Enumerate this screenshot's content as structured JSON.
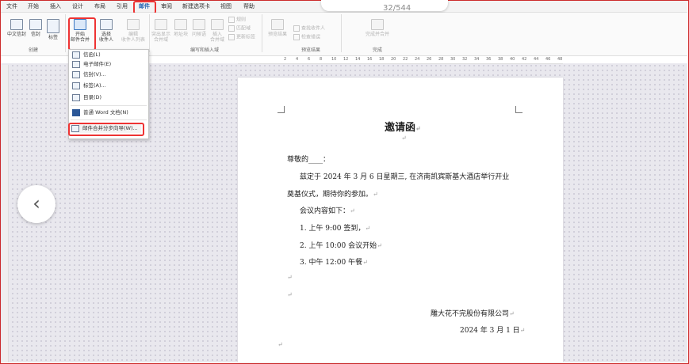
{
  "ribbon_tabs": [
    "文件",
    "开始",
    "插入",
    "设计",
    "布局",
    "引用",
    "邮件",
    "审阅",
    "新建选项卡",
    "视图",
    "帮助"
  ],
  "active_tab": "邮件",
  "page_counter": "32/544",
  "ribbon": {
    "chinese_envelope": "中文信封",
    "envelope": "信封",
    "labels": "标签",
    "start_mail_merge": [
      "开始",
      "邮件合并"
    ],
    "select_recipients": [
      "选择",
      "收件人"
    ],
    "edit_recipients": [
      "编辑",
      "收件人列表"
    ],
    "highlight_fields": [
      "突出显示",
      "合并域"
    ],
    "address_block": "地址块",
    "greeting_line": "问候语",
    "insert_merge_field": [
      "插入",
      "合并域"
    ],
    "rules": "规则",
    "match_fields": "匹配域",
    "update_labels": "更新标签",
    "preview_results": "预览结果",
    "find_recipient": "查找收件人",
    "check_errors": "检查错误",
    "finish_merge": "完成并合并",
    "groups": {
      "create": "创建",
      "write_insert": "编写和插入域",
      "preview": "预览结果",
      "finish": "完成"
    }
  },
  "dropdown": {
    "items": [
      "信函(L)",
      "电子邮件(E)",
      "信封(V)...",
      "标签(A)...",
      "目录(D)",
      "普通 Word 文档(N)",
      "邮件合并分步向导(W)..."
    ],
    "highlighted": "邮件合并分步向导(W)..."
  },
  "ruler_ticks": [
    "2",
    "4",
    "6",
    "8",
    "10",
    "12",
    "14",
    "16",
    "18",
    "20",
    "22",
    "24",
    "26",
    "28",
    "30",
    "32",
    "34",
    "36",
    "38",
    "40",
    "42",
    "44",
    "46",
    "48"
  ],
  "document": {
    "title": "邀请函",
    "salutation": "尊敬的____：",
    "body_line1": "兹定于 2024 年 3 月 6 日星期三, 在济南凯宾斯基大酒店举行开业",
    "body_line2": "奠基仪式，期待你的参加。",
    "agenda_intro": "会议内容如下：",
    "items": [
      "1.  上午 9:00 签到，",
      "2.  上午 10:00 会议开始",
      "3.  中午 12:00 午餐"
    ],
    "signature_company": "雕大花不完股份有限公司",
    "signature_date": "2024 年 3 月 1 日",
    "para_mark": "↵"
  },
  "colors": {
    "accent": "#1f5fb0",
    "highlight_border": "#e33333",
    "frame": "#cc2a2a"
  }
}
